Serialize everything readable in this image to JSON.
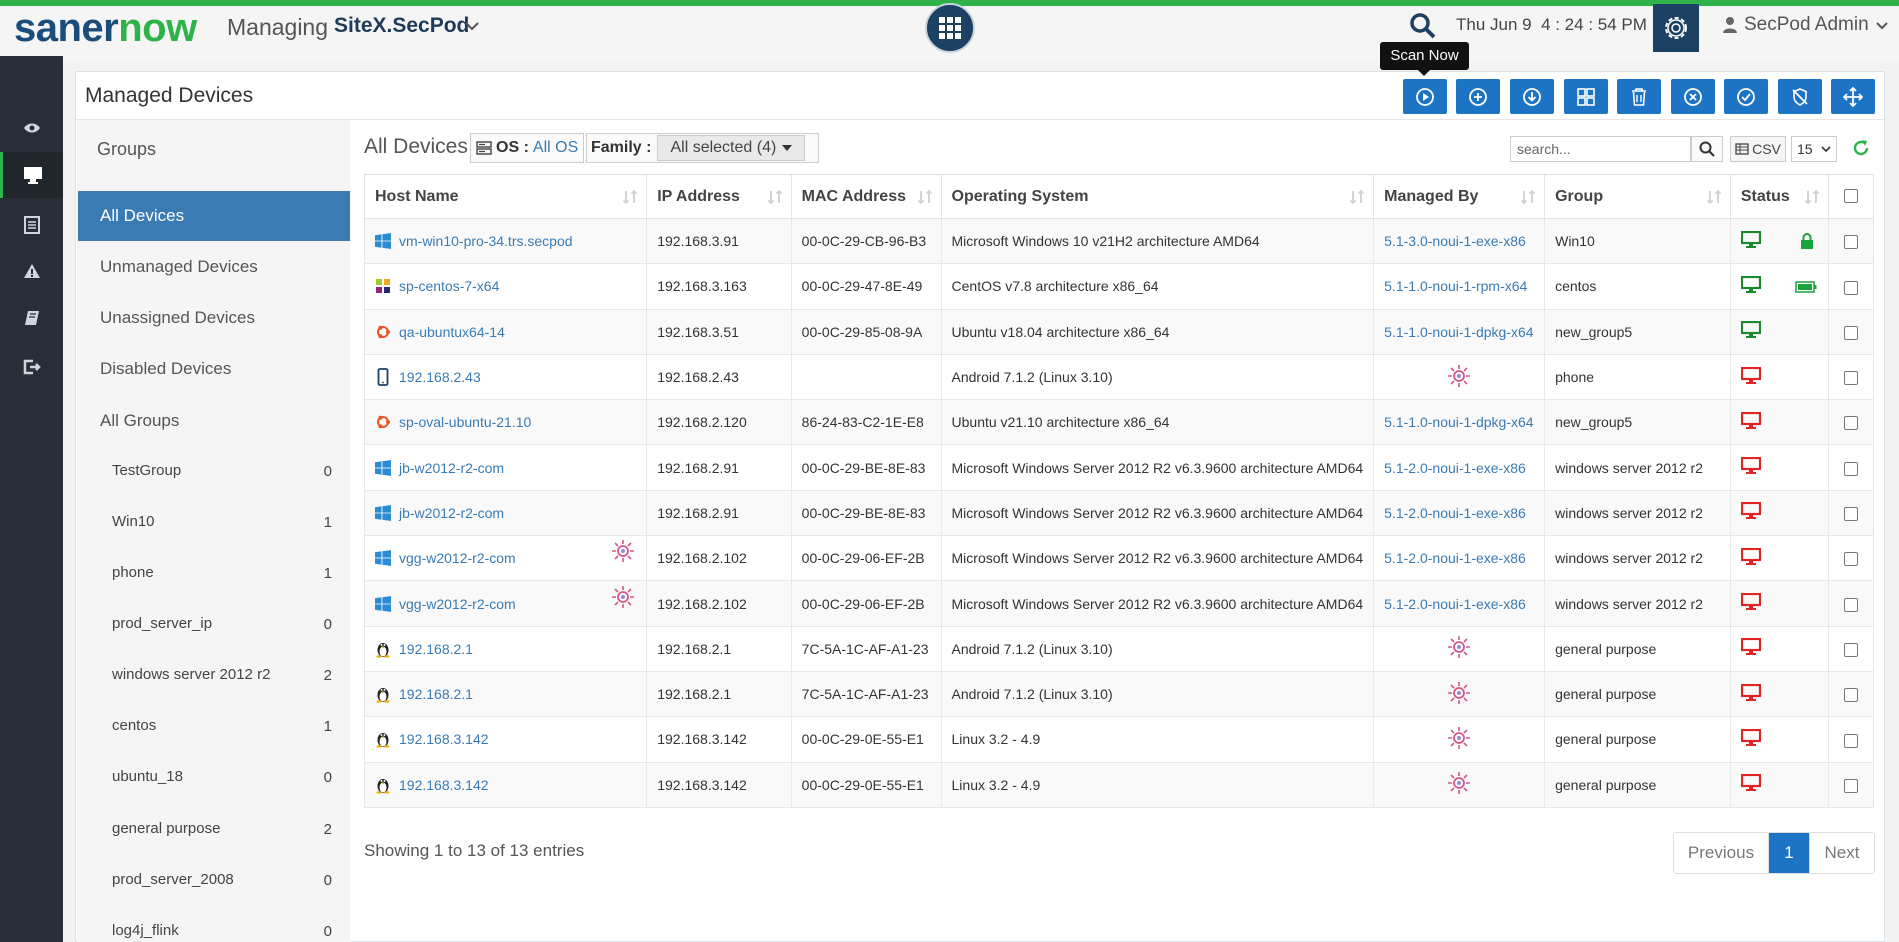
{
  "brand": {
    "part1": "saner",
    "part2": "now"
  },
  "header": {
    "managing_label": "Managing",
    "site": "SiteX.SecPod",
    "date": "Thu Jun 9",
    "time": "4 : 24 : 54 PM",
    "user": "SecPod Admin"
  },
  "page": {
    "title": "Managed Devices"
  },
  "tooltip": "Scan Now",
  "groups": {
    "heading": "Groups",
    "items": [
      "All Devices",
      "Unmanaged Devices",
      "Unassigned Devices",
      "Disabled Devices",
      "All Groups"
    ],
    "sub": [
      {
        "name": "TestGroup",
        "count": "0"
      },
      {
        "name": "Win10",
        "count": "1"
      },
      {
        "name": "phone",
        "count": "1"
      },
      {
        "name": "prod_server_ip",
        "count": "0"
      },
      {
        "name": "windows server 2012 r2",
        "count": "2"
      },
      {
        "name": "centos",
        "count": "1"
      },
      {
        "name": "ubuntu_18",
        "count": "0"
      },
      {
        "name": "general purpose",
        "count": "2"
      },
      {
        "name": "prod_server_2008",
        "count": "0"
      },
      {
        "name": "log4j_flink",
        "count": "0"
      }
    ]
  },
  "filters": {
    "title": "All Devices",
    "os_label": "OS :",
    "os_value": "All OS",
    "family_label": "Family :",
    "family_value": "All selected (4)",
    "search_placeholder": "search...",
    "csv_label": "CSV",
    "page_size": "15"
  },
  "table": {
    "columns": [
      "Host Name",
      "IP Address",
      "MAC Address",
      "Operating System",
      "Managed By",
      "Group",
      "Status"
    ],
    "rows": [
      {
        "icon": "windows",
        "host": "vm-win10-pro-34.trs.secpod",
        "ip": "192.168.3.91",
        "mac": "00-0C-29-CB-96-B3",
        "os": "Microsoft Windows 10 v21H2 architecture AMD64",
        "managed": "5.1-3.0-noui-1-exe-x86",
        "group": "Win10",
        "status": "online",
        "extra": "lock"
      },
      {
        "icon": "centos",
        "host": "sp-centos-7-x64",
        "ip": "192.168.3.163",
        "mac": "00-0C-29-47-8E-49",
        "os": "CentOS v7.8 architecture x86_64",
        "managed": "5.1-1.0-noui-1-rpm-x64",
        "group": "centos",
        "status": "online",
        "extra": "battery"
      },
      {
        "icon": "ubuntu",
        "host": "qa-ubuntux64-14",
        "ip": "192.168.3.51",
        "mac": "00-0C-29-85-08-9A",
        "os": "Ubuntu v18.04 architecture x86_64",
        "managed": "5.1-1.0-noui-1-dpkg-x64",
        "group": "new_group5",
        "status": "online"
      },
      {
        "icon": "mobile",
        "host": "192.168.2.43",
        "ip": "192.168.2.43",
        "mac": "",
        "os": "Android 7.1.2 (Linux 3.10)",
        "managed": "",
        "group": "phone",
        "status": "offline"
      },
      {
        "icon": "ubuntu",
        "host": "sp-oval-ubuntu-21.10",
        "ip": "192.168.2.120",
        "mac": "86-24-83-C2-1E-E8",
        "os": "Ubuntu v21.10 architecture x86_64",
        "managed": "5.1-1.0-noui-1-dpkg-x64",
        "group": "new_group5",
        "status": "offline"
      },
      {
        "icon": "windows",
        "host": "jb-w2012-r2-com",
        "ip": "192.168.2.91",
        "mac": "00-0C-29-BE-8E-83",
        "os": "Microsoft Windows Server 2012 R2 v6.3.9600 architecture AMD64",
        "managed": "5.1-2.0-noui-1-exe-x86",
        "group": "windows server 2012 r2",
        "status": "offline"
      },
      {
        "icon": "windows",
        "host": "jb-w2012-r2-com",
        "ip": "192.168.2.91",
        "mac": "00-0C-29-BE-8E-83",
        "os": "Microsoft Windows Server 2012 R2 v6.3.9600 architecture AMD64",
        "managed": "5.1-2.0-noui-1-exe-x86",
        "group": "windows server 2012 r2",
        "status": "offline"
      },
      {
        "icon": "windows",
        "host": "vgg-w2012-r2-com",
        "ip": "192.168.2.102",
        "mac": "00-0C-29-06-EF-2B",
        "os": "Microsoft Windows Server 2012 R2 v6.3.9600 architecture AMD64",
        "managed": "5.1-2.0-noui-1-exe-x86",
        "group": "windows server 2012 r2",
        "status": "offline",
        "hostbug": true
      },
      {
        "icon": "windows",
        "host": "vgg-w2012-r2-com",
        "ip": "192.168.2.102",
        "mac": "00-0C-29-06-EF-2B",
        "os": "Microsoft Windows Server 2012 R2 v6.3.9600 architecture AMD64",
        "managed": "5.1-2.0-noui-1-exe-x86",
        "group": "windows server 2012 r2",
        "status": "offline",
        "hostbug": true
      },
      {
        "icon": "linux",
        "host": "192.168.2.1",
        "ip": "192.168.2.1",
        "mac": "7C-5A-1C-AF-A1-23",
        "os": "Android 7.1.2 (Linux 3.10)",
        "managed": "",
        "group": "general purpose",
        "status": "offline"
      },
      {
        "icon": "linux",
        "host": "192.168.2.1",
        "ip": "192.168.2.1",
        "mac": "7C-5A-1C-AF-A1-23",
        "os": "Android 7.1.2 (Linux 3.10)",
        "managed": "",
        "group": "general purpose",
        "status": "offline"
      },
      {
        "icon": "linux",
        "host": "192.168.3.142",
        "ip": "192.168.3.142",
        "mac": "00-0C-29-0E-55-E1",
        "os": "Linux 3.2 - 4.9",
        "managed": "",
        "group": "general purpose",
        "status": "offline"
      },
      {
        "icon": "linux",
        "host": "192.168.3.142",
        "ip": "192.168.3.142",
        "mac": "00-0C-29-0E-55-E1",
        "os": "Linux 3.2 - 4.9",
        "managed": "",
        "group": "general purpose",
        "status": "offline"
      }
    ]
  },
  "footer": {
    "showing": "Showing 1 to 13 of 13 entries",
    "previous": "Previous",
    "page": "1",
    "next": "Next"
  },
  "colors": {
    "accent": "#1e74c4",
    "green": "#2eb34a",
    "navy": "#1d4163",
    "online": "#1b8a2e",
    "offline": "#e02424"
  }
}
